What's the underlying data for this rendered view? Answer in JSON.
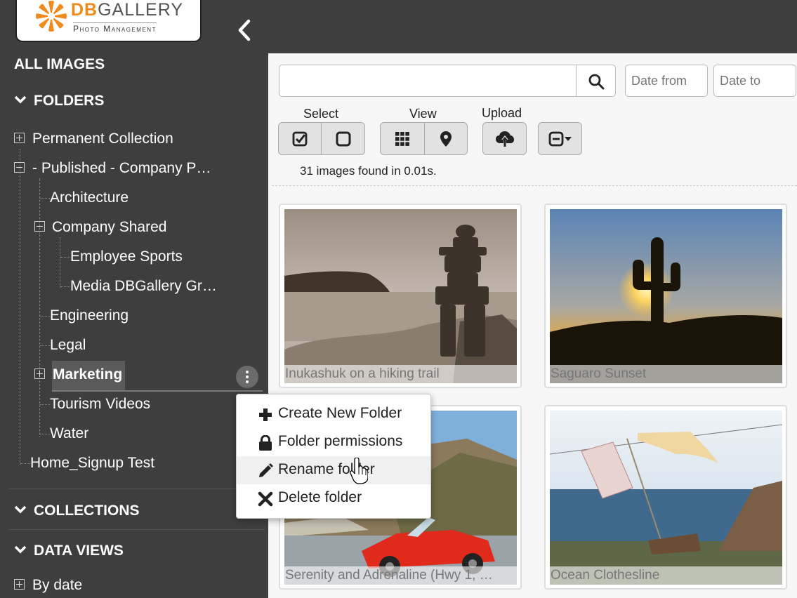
{
  "brand": {
    "logo_text_db": "DB",
    "logo_text_gallery": "GALLERY",
    "logo_subtitle": "Photo Management",
    "accent_color": "#f08a1c"
  },
  "sidebar": {
    "all_images": "ALL IMAGES",
    "folders_heading": "FOLDERS",
    "collections_heading": "COLLECTIONS",
    "data_views_heading": "DATA VIEWS",
    "folders": [
      {
        "label": "Permanent Collection",
        "expander": "plus"
      },
      {
        "label": "- Published - Company P…",
        "expander": "minus"
      },
      {
        "label": "Architecture"
      },
      {
        "label": "Company Shared",
        "expander": "minus"
      },
      {
        "label": "Employee Sports"
      },
      {
        "label": "Media DBGallery Gr…"
      },
      {
        "label": "Engineering"
      },
      {
        "label": "Legal"
      },
      {
        "label": "Marketing",
        "expander": "plus",
        "selected": true
      },
      {
        "label": "Tourism Videos"
      },
      {
        "label": "Water"
      },
      {
        "label": "Home_Signup Test"
      }
    ],
    "data_views": [
      {
        "label": "By date",
        "expander": "plus"
      }
    ]
  },
  "toolbar": {
    "search_value": "",
    "date_from_placeholder": "Date from",
    "date_to_placeholder": "Date to",
    "select_label": "Select",
    "view_label": "View",
    "upload_label": "Upload"
  },
  "results": {
    "count_text": "31 images found in 0.01s."
  },
  "images": [
    {
      "caption": "Inukashuk on a hiking trail"
    },
    {
      "caption": "Saguaro Sunset"
    },
    {
      "caption": "Serenity and Adrenaline (Hwy 1, …"
    },
    {
      "caption": "Ocean Clothesline"
    }
  ],
  "context_menu": {
    "items": [
      {
        "label": "Create New Folder",
        "icon": "plus-icon"
      },
      {
        "label": "Folder permissions",
        "icon": "lock-icon"
      },
      {
        "label": "Rename folder",
        "icon": "pencil-icon",
        "hovered": true
      },
      {
        "label": "Delete folder",
        "icon": "x-icon"
      }
    ]
  }
}
